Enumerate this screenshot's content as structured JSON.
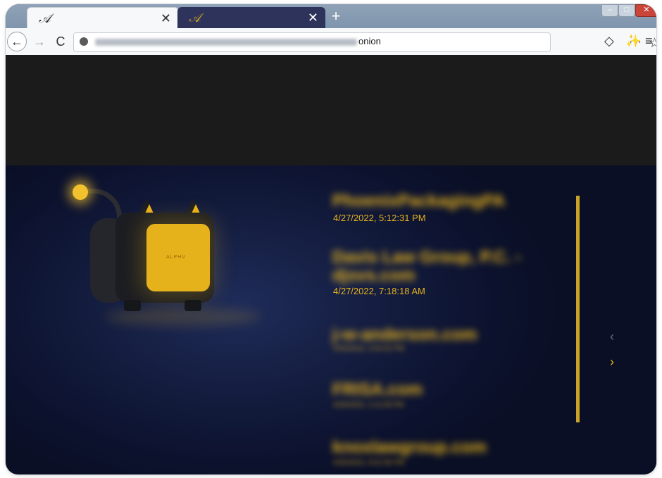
{
  "browser": {
    "tabs": [
      {
        "favicon": "𝒜",
        "close": "✕"
      },
      {
        "favicon": "𝒜",
        "close": "✕"
      }
    ],
    "new_tab": "+",
    "nav": {
      "back": "←",
      "forward": "→",
      "reload": "C"
    },
    "url_suffix": "onion",
    "page_actions": "···",
    "star": "☆",
    "shield": "◇",
    "wand": "✨",
    "menu": "≡",
    "window_controls": {
      "minimize": "–",
      "maximize": "□",
      "close": "✕"
    }
  },
  "hero": {
    "device_label": "ALPHV"
  },
  "entries": [
    {
      "name": "PhoenixPackagingPA",
      "date": "4/27/2022, 5:12:31 PM"
    },
    {
      "name": "Davis Law Group, P.C. -",
      "name2": "djsvs.com",
      "date": "4/27/2022, 7:18:18 AM"
    },
    {
      "name": "j-w-anderson.com",
      "date": "4/26/2022, 3:04:42 PM"
    },
    {
      "name": "FRISA.com",
      "date": "4/26/2022, 2:11:08 PM"
    },
    {
      "name": "knoxlawgroup.com",
      "date": "4/25/2022, 8:31:55 PM"
    }
  ],
  "pager": {
    "prev": "‹",
    "next": "›"
  },
  "colors": {
    "accent": "#e6b21c",
    "hero_bg": "#0f1733",
    "top_bg": "#1b1b1c"
  }
}
